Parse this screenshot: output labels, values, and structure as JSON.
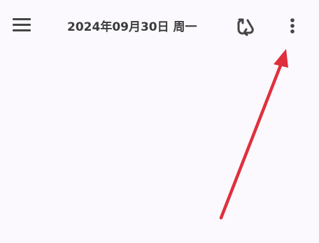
{
  "toolbar": {
    "menu_icon": "hamburger-menu-icon",
    "title": "2024年09月30日 周一",
    "sync_icon": "sync-icon",
    "more_icon": "more-vertical-icon"
  },
  "colors": {
    "background": "#fbf9fd",
    "icon": "#454545",
    "title": "#3b3b3b",
    "annotation_arrow": "#e0303d"
  }
}
